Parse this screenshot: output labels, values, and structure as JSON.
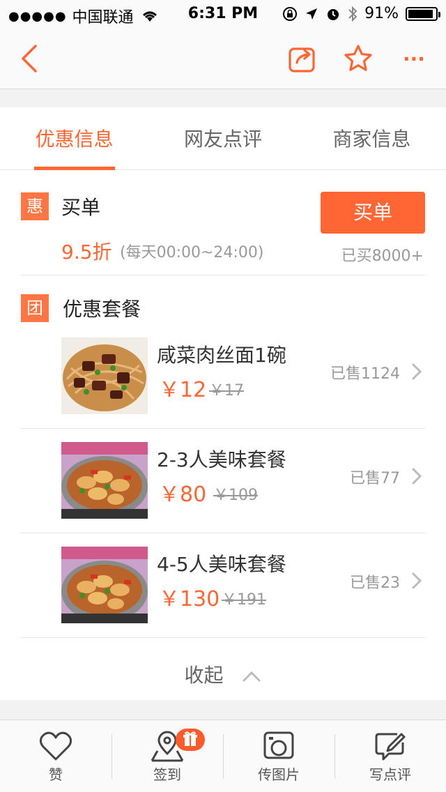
{
  "status_bar": {
    "signal_dots": "●●●●●",
    "carrier": "中国联通",
    "time": "6:31 PM",
    "battery": "91%",
    "battery_level": 0.91
  },
  "nav": {
    "back_icon": "chevron-left-icon",
    "share_icon": "share-icon",
    "favorite_icon": "star-icon",
    "more_label": "···"
  },
  "accent_color": "#ff6633",
  "tabs": [
    {
      "label": "优惠信息",
      "active": true
    },
    {
      "label": "网友点评",
      "active": false
    },
    {
      "label": "商家信息",
      "active": false
    }
  ],
  "buy_section": {
    "tag": "惠",
    "title": "买单",
    "discount": "9.5折",
    "time": "(每天00:00~24:00)",
    "button": "买单",
    "bought": "已买8000+"
  },
  "package_section": {
    "tag": "团",
    "title": "优惠套餐"
  },
  "deals": [
    {
      "name": "咸菜肉丝面1碗",
      "price": "￥12",
      "old_price": "￥17",
      "sold": "已售1124"
    },
    {
      "name": "2-3人美味套餐",
      "price": "￥80",
      "old_price": "￥109",
      "sold": "已售77"
    },
    {
      "name": "4-5人美味套餐",
      "price": "￥130",
      "old_price": "￥191",
      "sold": "已售23"
    }
  ],
  "collapse_label": "收起",
  "toolbar": [
    {
      "label": "赞",
      "icon": "heart-icon"
    },
    {
      "label": "签到",
      "icon": "location-pin-icon"
    },
    {
      "label": "传图片",
      "icon": "photo-icon"
    },
    {
      "label": "写点评",
      "icon": "edit-review-icon"
    }
  ]
}
